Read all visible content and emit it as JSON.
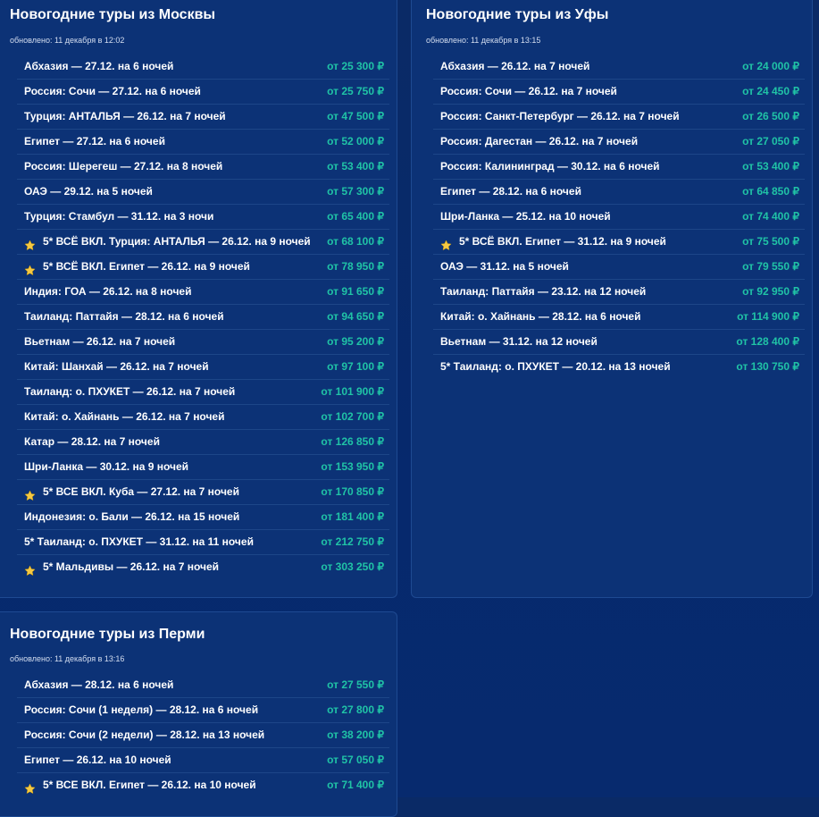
{
  "panels": [
    {
      "id": "panel-moscow",
      "title": "Новогодние туры из Москвы",
      "updated": "обновлено: 11 декабря в 12:02",
      "tours": [
        {
          "name": "Абхазия — 27.12. на 6 ночей",
          "price": "от 25 300 ₽",
          "featured": false
        },
        {
          "name": "Россия: Сочи — 27.12. на 6 ночей",
          "price": "от 25 750 ₽",
          "featured": false
        },
        {
          "name": "Турция: АНТАЛЬЯ — 26.12. на 7 ночей",
          "price": "от 47 500 ₽",
          "featured": false
        },
        {
          "name": "Египет — 27.12. на 6 ночей",
          "price": "от 52 000 ₽",
          "featured": false
        },
        {
          "name": "Россия: Шерегеш — 27.12. на 8 ночей",
          "price": "от 53 400 ₽",
          "featured": false
        },
        {
          "name": "ОАЭ — 29.12. на 5 ночей",
          "price": "от 57 300 ₽",
          "featured": false
        },
        {
          "name": "Турция: Стамбул — 31.12. на 3 ночи",
          "price": "от 65 400 ₽",
          "featured": false
        },
        {
          "name": "5* ВСЁ ВКЛ. Турция: АНТАЛЬЯ — 26.12. на 9 ночей",
          "price": "от 68 100 ₽",
          "featured": true
        },
        {
          "name": "5* ВСЁ ВКЛ. Египет — 26.12. на 9 ночей",
          "price": "от 78 950 ₽",
          "featured": true
        },
        {
          "name": "Индия: ГОА — 26.12. на 8 ночей",
          "price": "от 91 650 ₽",
          "featured": false
        },
        {
          "name": "Таиланд: Паттайя — 28.12. на 6 ночей",
          "price": "от 94 650 ₽",
          "featured": false
        },
        {
          "name": "Вьетнам — 26.12. на 7 ночей",
          "price": "от 95 200 ₽",
          "featured": false
        },
        {
          "name": "Китай: Шанхай — 26.12. на 7 ночей",
          "price": "от 97 100 ₽",
          "featured": false
        },
        {
          "name": "Таиланд: о. ПХУКЕТ — 26.12. на 7 ночей",
          "price": "от 101 900 ₽",
          "featured": false
        },
        {
          "name": "Китай: о. Хайнань — 26.12. на 7 ночей",
          "price": "от 102 700 ₽",
          "featured": false
        },
        {
          "name": "Катар — 28.12. на 7 ночей",
          "price": "от 126 850 ₽",
          "featured": false
        },
        {
          "name": "Шри-Ланка — 30.12. на 9 ночей",
          "price": "от 153 950 ₽",
          "featured": false
        },
        {
          "name": "5* ВСЕ ВКЛ. Куба — 27.12. на 7 ночей",
          "price": "от 170 850 ₽",
          "featured": true
        },
        {
          "name": "Индонезия: о. Бали — 26.12. на 15 ночей",
          "price": "от 181 400 ₽",
          "featured": false
        },
        {
          "name": "5* Таиланд: о. ПХУКЕТ — 31.12. на 11 ночей",
          "price": "от 212 750 ₽",
          "featured": false
        },
        {
          "name": "5* Мальдивы — 26.12. на 7 ночей",
          "price": "от 303 250 ₽",
          "featured": true
        }
      ]
    },
    {
      "id": "panel-ufa",
      "title": "Новогодние туры из Уфы",
      "updated": "обновлено: 11 декабря в 13:15",
      "tours": [
        {
          "name": "Абхазия — 26.12. на 7 ночей",
          "price": "от 24 000 ₽",
          "featured": false
        },
        {
          "name": "Россия: Сочи — 26.12. на 7 ночей",
          "price": "от 24 450 ₽",
          "featured": false
        },
        {
          "name": "Россия: Санкт-Петербург — 26.12. на 7 ночей",
          "price": "от 26 500 ₽",
          "featured": false
        },
        {
          "name": "Россия: Дагестан — 26.12. на 7 ночей",
          "price": "от 27 050 ₽",
          "featured": false
        },
        {
          "name": "Россия: Калининград — 30.12. на 6 ночей",
          "price": "от 53 400 ₽",
          "featured": false
        },
        {
          "name": "Египет — 28.12. на 6 ночей",
          "price": "от 64 850 ₽",
          "featured": false
        },
        {
          "name": "Шри-Ланка — 25.12. на 10 ночей",
          "price": "от 74 400 ₽",
          "featured": false
        },
        {
          "name": "5* ВСЁ ВКЛ. Египет — 31.12. на 9 ночей",
          "price": "от 75 500 ₽",
          "featured": true
        },
        {
          "name": "ОАЭ — 31.12. на 5 ночей",
          "price": "от 79 550 ₽",
          "featured": false
        },
        {
          "name": "Таиланд: Паттайя — 23.12. на 12 ночей",
          "price": "от 92 950 ₽",
          "featured": false
        },
        {
          "name": "Китай: о. Хайнань — 28.12. на 6 ночей",
          "price": "от 114 900 ₽",
          "featured": false
        },
        {
          "name": "Вьетнам — 31.12. на 12 ночей",
          "price": "от 128 400 ₽",
          "featured": false
        },
        {
          "name": "5* Таиланд: о. ПХУКЕТ — 20.12. на 13 ночей",
          "price": "от 130 750 ₽",
          "featured": false
        }
      ]
    },
    {
      "id": "panel-perm",
      "title": "Новогодние туры из Перми",
      "updated": "обновлено: 11 декабря в 13:16",
      "tours": [
        {
          "name": "Абхазия — 28.12. на 6 ночей",
          "price": "от 27 550 ₽",
          "featured": false
        },
        {
          "name": "Россия: Сочи (1 неделя) — 28.12. на 6 ночей",
          "price": "от 27 800 ₽",
          "featured": false
        },
        {
          "name": "Россия: Сочи (2 недели) — 28.12. на 13 ночей",
          "price": "от 38 200 ₽",
          "featured": false
        },
        {
          "name": "Египет — 26.12. на 10 ночей",
          "price": "от 57 050 ₽",
          "featured": false
        },
        {
          "name": "5* ВСЕ ВКЛ. Египет — 26.12. на 10 ночей",
          "price": "от 71 400 ₽",
          "featured": true
        }
      ]
    }
  ],
  "colors": {
    "background": "#072a6e",
    "panel": "#0c3276",
    "price": "#20c3a6",
    "star": "#f5c842"
  },
  "icons": {
    "featured": "star-icon"
  }
}
